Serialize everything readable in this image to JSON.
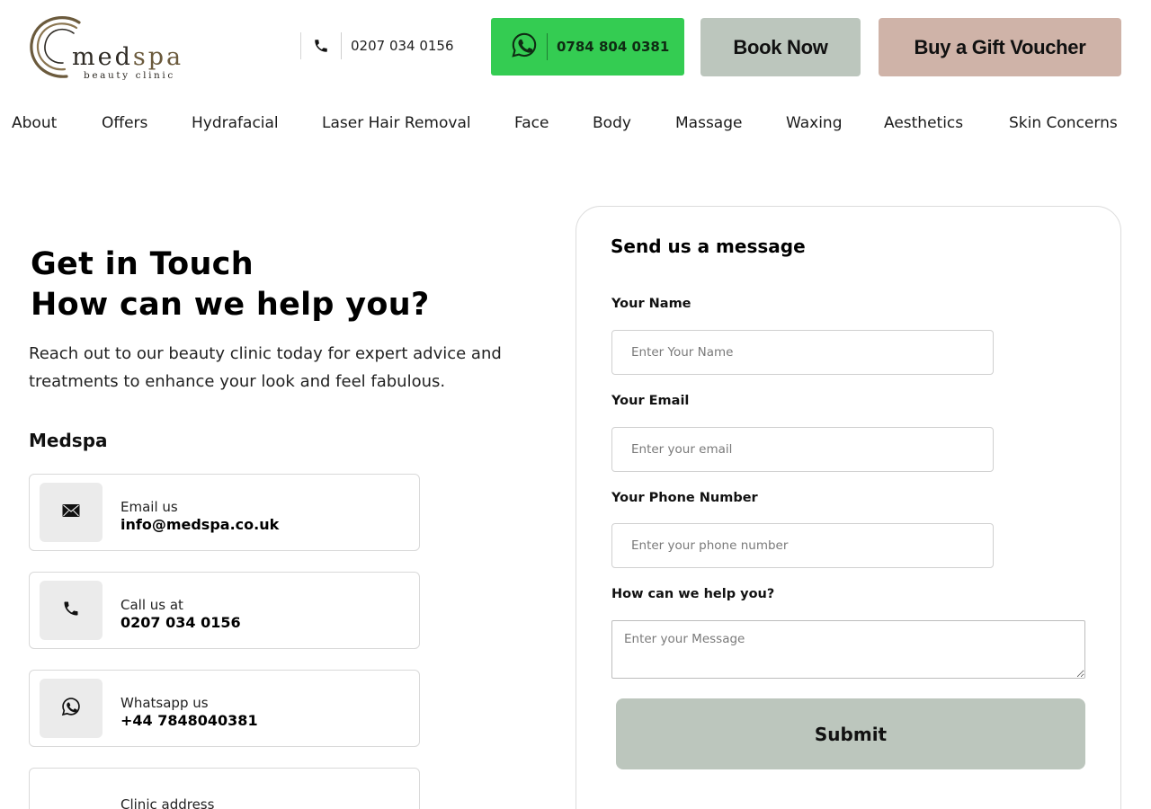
{
  "header": {
    "logo": {
      "word_main": "med",
      "word_accent": "spa",
      "tagline": "beauty clinic",
      "icon": "swirl-logo-icon"
    },
    "phone": {
      "number": "0207 034 0156",
      "icon": "phone-icon"
    },
    "whatsapp": {
      "number": "0784 804 0381",
      "icon": "whatsapp-icon",
      "color": "#34cc52"
    },
    "book_label": "Book Now",
    "voucher_label": "Buy a Gift Voucher",
    "colors": {
      "book": "#bcc6bd",
      "voucher": "#cfb3a8"
    }
  },
  "nav": {
    "items": [
      {
        "label": "About"
      },
      {
        "label": "Offers"
      },
      {
        "label": "Hydrafacial"
      },
      {
        "label": "Laser Hair Removal"
      },
      {
        "label": "Face"
      },
      {
        "label": "Body"
      },
      {
        "label": "Massage"
      },
      {
        "label": "Waxing"
      },
      {
        "label": "Aesthetics"
      },
      {
        "label": "Skin Concerns"
      }
    ]
  },
  "main": {
    "heading_line1": "Get in Touch",
    "heading_line2": "How can we help you?",
    "intro": "Reach out to our beauty clinic today for expert advice and treatments to enhance your look and feel fabulous.",
    "brand": "Medspa",
    "contacts": [
      {
        "label": "Email us",
        "value": "info@medspa.co.uk",
        "icon": "envelope-icon"
      },
      {
        "label": "Call us at",
        "value": "0207 034 0156",
        "icon": "phone-icon"
      },
      {
        "label": "Whatsapp us",
        "value": "+44 7848040381",
        "icon": "whatsapp-icon"
      },
      {
        "label": "Clinic  address",
        "value": "",
        "icon": "location-icon"
      }
    ]
  },
  "form": {
    "title": "Send us a message",
    "name_label": "Your Name",
    "name_placeholder": "Enter Your Name",
    "email_label": "Your Email",
    "email_placeholder": "Enter your email",
    "phone_label": "Your Phone Number",
    "phone_placeholder": "Enter your phone number",
    "message_label": "How can we help you?",
    "message_placeholder": "Enter your Message",
    "submit_label": "Submit"
  }
}
